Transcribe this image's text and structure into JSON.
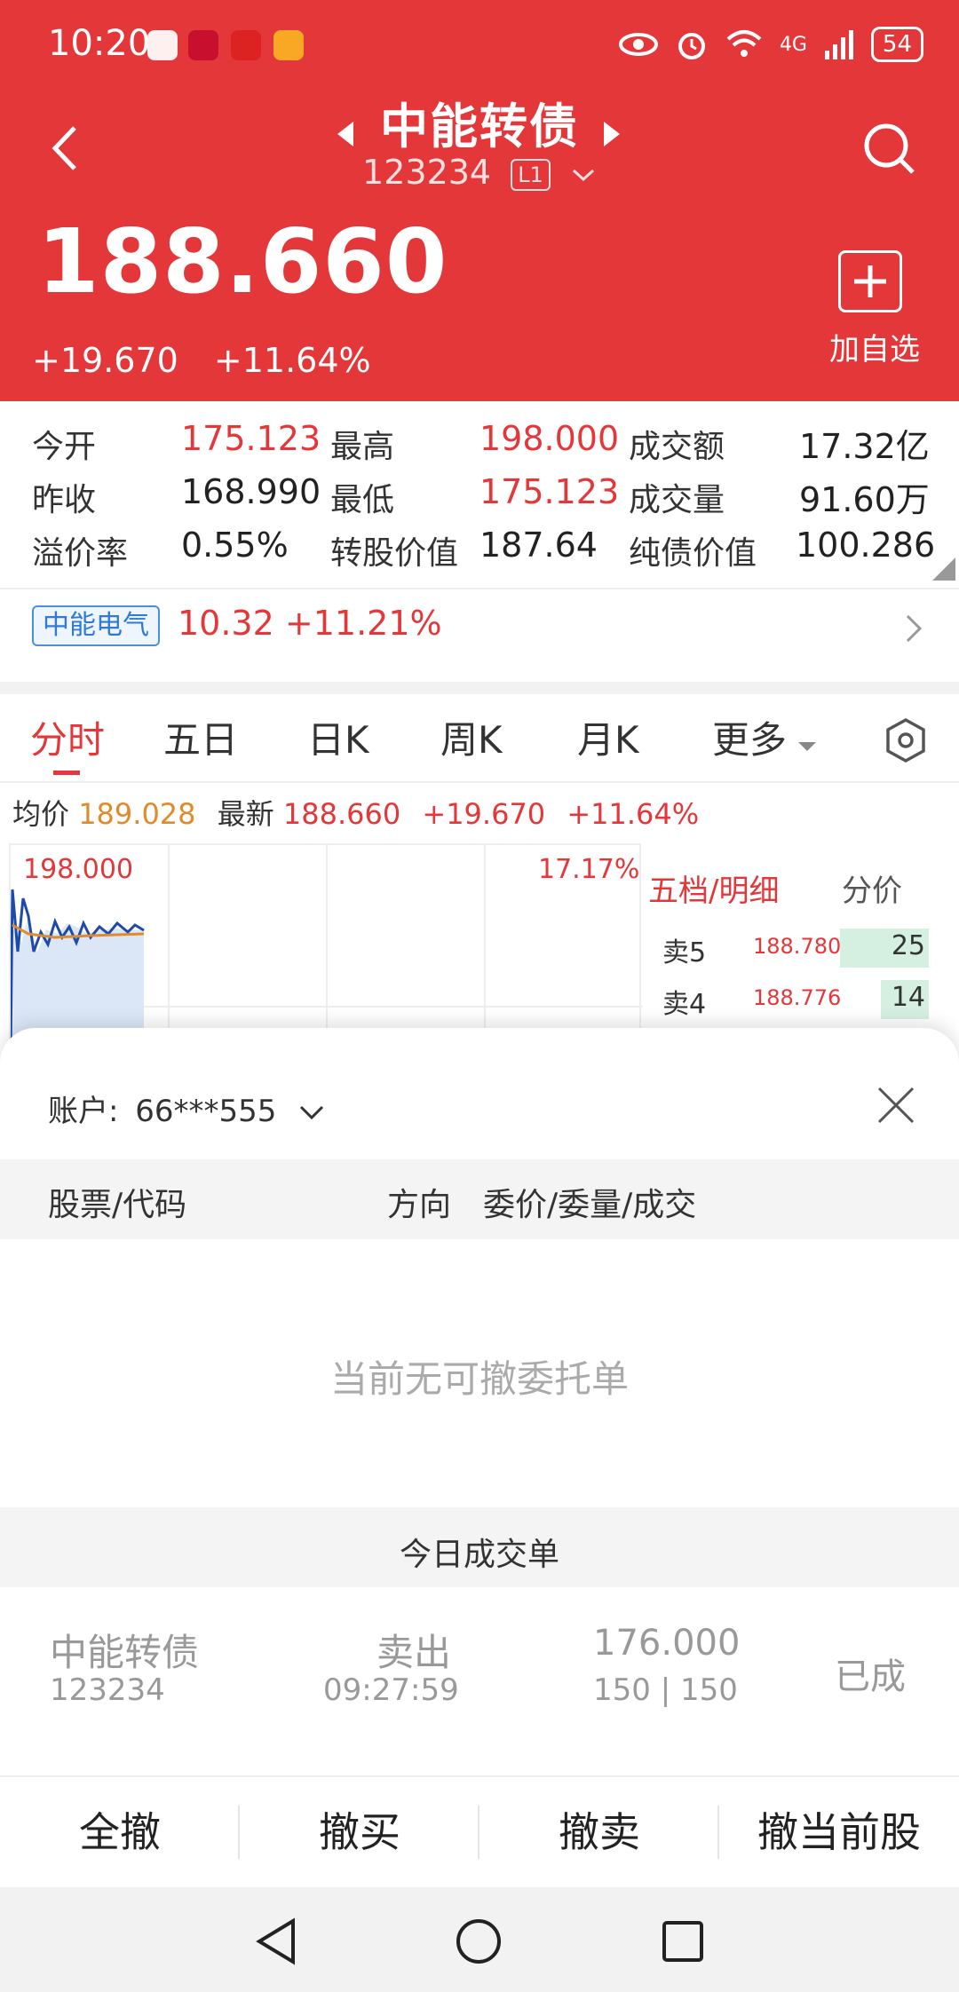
{
  "status_bar": {
    "time": "10:20",
    "network": "4G",
    "battery": "54"
  },
  "header": {
    "stock_name": "中能转债",
    "stock_code": "123234",
    "level": "L1",
    "price": "188.660",
    "change": "+19.670",
    "change_pct": "+11.64%",
    "add_watchlist_label": "加自选",
    "colors": {
      "header_bg": "#e3373a",
      "up": "#e3373a",
      "down": "#1f9d55"
    }
  },
  "stats": {
    "rows": [
      [
        {
          "label": "今开",
          "value": "175.123"
        },
        {
          "label": "最高",
          "value": "198.000"
        },
        {
          "label": "成交额",
          "value": "17.32亿"
        }
      ],
      [
        {
          "label": "昨收",
          "value": "168.990"
        },
        {
          "label": "最低",
          "value": "175.123"
        },
        {
          "label": "成交量",
          "value": "91.60万"
        }
      ],
      [
        {
          "label": "溢价率",
          "value": "0.55%"
        },
        {
          "label": "转股价值",
          "value": "187.64"
        },
        {
          "label": "纯债价值",
          "value": "100.286"
        }
      ]
    ]
  },
  "related": {
    "tag": "中能电气",
    "price": "10.32",
    "change_pct": "+11.21%"
  },
  "tabs": {
    "items": [
      "分时",
      "五日",
      "日K",
      "周K",
      "月K",
      "更多"
    ],
    "active": "分时"
  },
  "chart_info": {
    "avg_label": "均价",
    "avg_value": "189.028",
    "latest_label": "最新",
    "latest_value": "188.660",
    "change": "+19.670",
    "change_pct": "+11.64%",
    "y_max": "198.000",
    "pct_max": "17.17%"
  },
  "order_book": {
    "tab1": "五档/明细",
    "tab2": "分价",
    "rows": [
      {
        "label": "卖5",
        "price": "188.780",
        "vol": "25"
      },
      {
        "label": "卖4",
        "price": "188.776",
        "vol": "14"
      }
    ]
  },
  "sheet": {
    "account_label": "账户:",
    "account_value": "66***555",
    "table_headers": {
      "stock": "股票/代码",
      "direction": "方向",
      "price_qty": "委价/委量/成交"
    },
    "empty_text": "当前无可撤委托单",
    "today_title": "今日成交单",
    "trade": {
      "name": "中能转债",
      "code": "123234",
      "direction": "卖出",
      "time": "09:27:59",
      "price": "176.000",
      "qty": "150 | 150",
      "status": "已成"
    },
    "actions": [
      "全撤",
      "撤买",
      "撤卖",
      "撤当前股"
    ]
  }
}
